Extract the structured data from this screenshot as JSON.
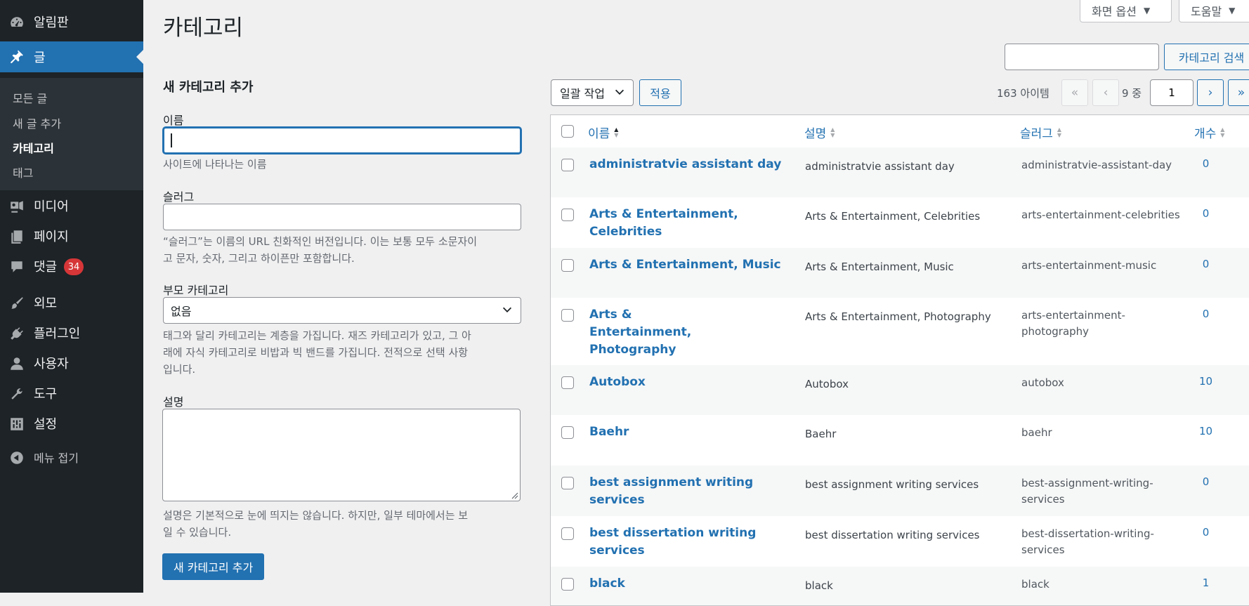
{
  "colors": {
    "accent": "#2271b1",
    "menu_bg": "#1d2327",
    "badge": "#d63638"
  },
  "menu": {
    "dashboard": {
      "label": "알림판",
      "icon": "dashboard-icon"
    },
    "posts": {
      "label": "글",
      "icon": "pin-icon"
    },
    "sub": {
      "all": "모든 글",
      "new": "새 글 추가",
      "categories": "카테고리",
      "tags": "태그"
    },
    "media": {
      "label": "미디어",
      "icon": "media-icon"
    },
    "pages": {
      "label": "페이지",
      "icon": "pages-icon"
    },
    "comments": {
      "label": "댓글",
      "icon": "comment-icon",
      "badge": "34"
    },
    "appearance": {
      "label": "외모",
      "icon": "brush-icon"
    },
    "plugins": {
      "label": "플러그인",
      "icon": "plugin-icon"
    },
    "users": {
      "label": "사용자",
      "icon": "user-icon"
    },
    "tools": {
      "label": "도구",
      "icon": "wrench-icon"
    },
    "settings": {
      "label": "설정",
      "icon": "settings-icon"
    },
    "collapse": {
      "label": "메뉴 접기",
      "icon": "collapse-icon"
    }
  },
  "top": {
    "screen_options": "화면 옵션",
    "help": "도움말"
  },
  "page_title": "카테고리",
  "form": {
    "title": "새 카테고리 추가",
    "name_label": "이름",
    "name_value": "",
    "name_help": "사이트에 나타나는 이름",
    "slug_label": "슬러그",
    "slug_help_1": "“슬러그”는 이름의 URL 친화적인 버전입니다. 이는 보통 모두 소문자이",
    "slug_help_2": "고 문자, 숫자, 그리고 하이픈만 포함합니다.",
    "parent_label": "부모 카테고리",
    "parent_value": "없음",
    "parent_help_1": "태그와 달리 카테고리는 계층을 가집니다. 재즈 카테고리가 있고, 그 아",
    "parent_help_2": "래에 자식 카테고리로 비밥과 빅 밴드를 가집니다. 전적으로 선택 사항",
    "parent_help_3": "입니다.",
    "desc_label": "설명",
    "desc_help_1": "설명은 기본적으로 눈에 띄지는 않습니다. 하지만, 일부 테마에서는 보",
    "desc_help_2": "일 수 있습니다.",
    "submit": "새 카테고리 추가"
  },
  "search": {
    "button": "카테고리 검색"
  },
  "tablenav": {
    "bulk_action": "일괄 작업",
    "apply": "적용",
    "items": "163 아이템",
    "first": "«",
    "prev": "‹",
    "current_page": "1",
    "of_text": "9 중",
    "next": "›",
    "last": "»"
  },
  "table": {
    "headers": {
      "name": "이름",
      "description": "설명",
      "slug": "슬러그",
      "count": "개수"
    },
    "rows": [
      {
        "name": "administratvie assistant day",
        "description": "administratvie assistant day",
        "slug": "administratvie-assistant-day",
        "count": "0"
      },
      {
        "name": "Arts & Entertainment, Celebrities",
        "description": "Arts & Entertainment, Celebrities",
        "slug": "arts-entertainment-celebrities",
        "count": "0"
      },
      {
        "name": "Arts & Entertainment, Music",
        "description": "Arts & Entertainment, Music",
        "slug": "arts-entertainment-music",
        "count": "0"
      },
      {
        "name": "Arts & Entertainment, Photography",
        "description": "Arts & Entertainment, Photography",
        "slug": "arts-entertainment-photography",
        "count": "0"
      },
      {
        "name": "Autobox",
        "description": "Autobox",
        "slug": "autobox",
        "count": "10"
      },
      {
        "name": "Baehr",
        "description": "Baehr",
        "slug": "baehr",
        "count": "10"
      },
      {
        "name": "best assignment writing services",
        "description": "best assignment writing services",
        "slug": "best-assignment-writing-services",
        "count": "0"
      },
      {
        "name": "best dissertation writing services",
        "description": "best dissertation writing services",
        "slug": "best-dissertation-writing-services",
        "count": "0"
      },
      {
        "name": "black",
        "description": "black",
        "slug": "black",
        "count": "1"
      }
    ]
  }
}
